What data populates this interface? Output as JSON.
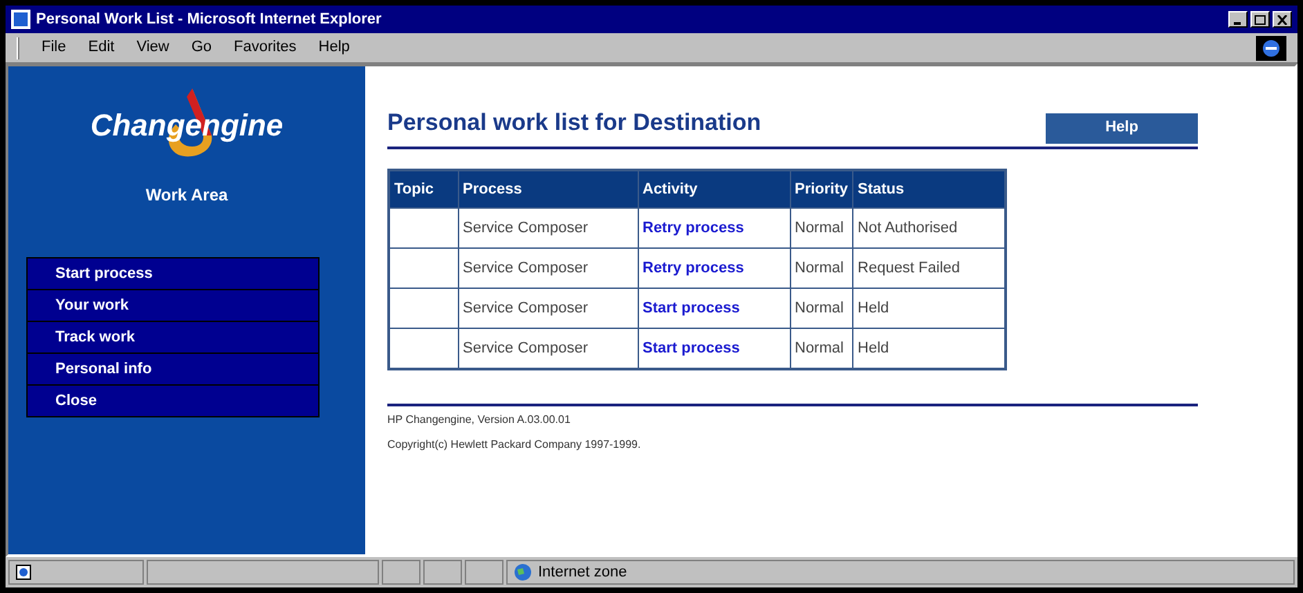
{
  "window": {
    "title": "Personal Work List - Microsoft Internet Explorer"
  },
  "menu": [
    "File",
    "Edit",
    "View",
    "Go",
    "Favorites",
    "Help"
  ],
  "sidebar": {
    "logo": "Changengine",
    "heading": "Work Area",
    "items": [
      {
        "label": "Start process"
      },
      {
        "label": "Your work"
      },
      {
        "label": "Track work"
      },
      {
        "label": "Personal info"
      },
      {
        "label": "Close"
      }
    ]
  },
  "page": {
    "title": "Personal work list for Destination",
    "help_button": "Help"
  },
  "table": {
    "columns": [
      "Topic",
      "Process",
      "Activity",
      "Priority",
      "Status"
    ],
    "rows": [
      {
        "topic": "",
        "process": "Service Composer",
        "activity": "Retry process",
        "priority": "Normal",
        "status": "Not Authorised"
      },
      {
        "topic": "",
        "process": "Service Composer",
        "activity": "Retry process",
        "priority": "Normal",
        "status": "Request Failed"
      },
      {
        "topic": "",
        "process": "Service Composer",
        "activity": "Start process",
        "priority": "Normal",
        "status": "Held"
      },
      {
        "topic": "",
        "process": "Service Composer",
        "activity": "Start process",
        "priority": "Normal",
        "status": "Held"
      }
    ]
  },
  "footer": [
    "HP Changengine, Version A.03.00.01",
    "Copyright(c) Hewlett Packard Company 1997-1999."
  ],
  "status_bar": {
    "zone": "Internet zone"
  }
}
